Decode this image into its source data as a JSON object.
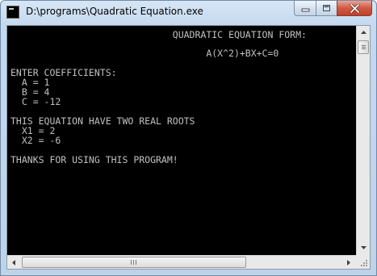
{
  "window": {
    "title": "D:\\programs\\Quadratic Equation.exe",
    "close_color": "#c7432b",
    "console_bg": "#000000",
    "console_fg": "#c0c0c0"
  },
  "console": {
    "lines": [
      "                             QUADRATIC EQUATION FORM:",
      "",
      "                                   A(X^2)+BX+C=0",
      "",
      "ENTER COEFFICIENTS:",
      "  A = 1",
      "  B = 4",
      "  C = -12",
      "",
      "THIS EQUATION HAVE TWO REAL ROOTS",
      "  X1 = 2",
      "  X2 = -6",
      "",
      "THANKS FOR USING THIS PROGRAM!"
    ]
  },
  "scrollbars": {
    "vertical": {
      "position": 0.0
    },
    "horizontal": {
      "position": 0.0
    }
  }
}
